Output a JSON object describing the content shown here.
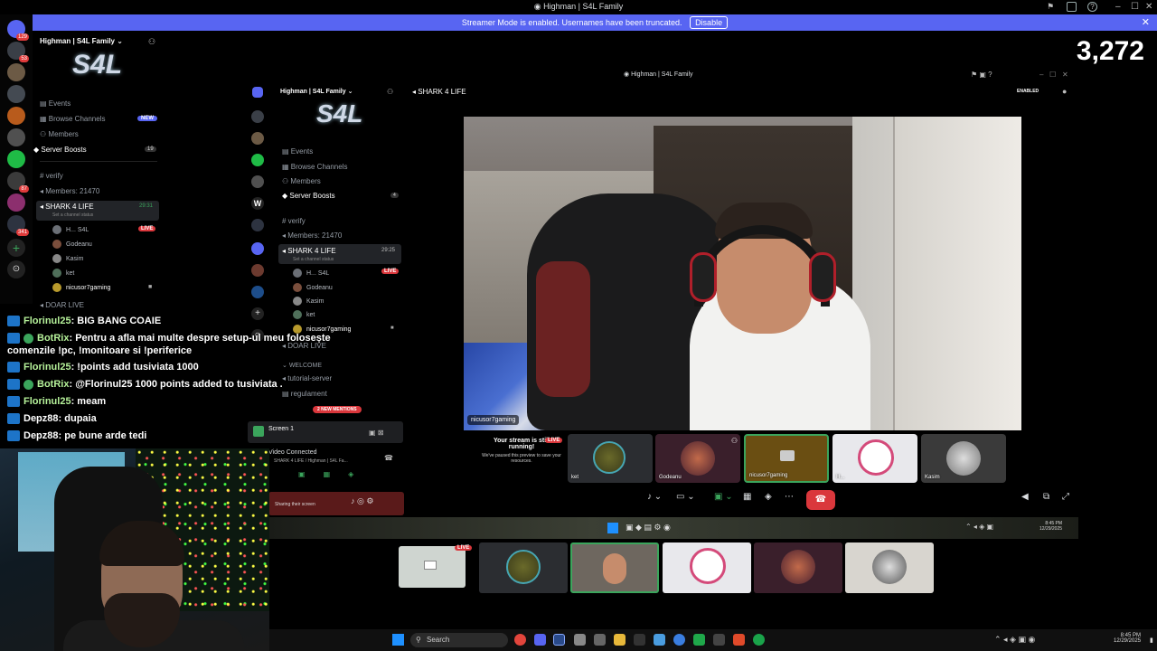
{
  "window": {
    "title": "Highman | S4L Family",
    "inner_title": "Highman | S4L Family"
  },
  "banner": {
    "text": "Streamer Mode is enabled. Usernames have been truncated.",
    "disable_label": "Disable"
  },
  "viewer_count": "3,272",
  "left_sidebar": {
    "server_name": "Highman | S4L Family",
    "logo_text": "S4L",
    "items": [
      {
        "label": "Events"
      },
      {
        "label": "Browse Channels",
        "badge": "NEW"
      },
      {
        "label": "Members"
      },
      {
        "label": "Server Boosts",
        "badge": "19"
      }
    ],
    "channels": [
      {
        "label": "verify"
      },
      {
        "label": "Members: 21470"
      },
      {
        "label": "SHARK 4 LIFE",
        "time": "29:31",
        "status": "Set a channel status"
      }
    ],
    "voice_users": [
      {
        "name": "H... S4L",
        "live": "LIVE"
      },
      {
        "name": "Godeanu"
      },
      {
        "name": "Kasim"
      },
      {
        "name": "ket"
      },
      {
        "name": "nicusor7gaming"
      }
    ],
    "after_channel": "DOAR LIVE"
  },
  "server_rail_badges": [
    "129",
    "53",
    "87",
    "341"
  ],
  "chat": [
    {
      "user": "Florinul25",
      "message": "BIG BANG COAIE"
    },
    {
      "user": "BotRix",
      "message": "Pentru a afla mai multe despre setup-ul meu folosește"
    },
    {
      "user": "",
      "message": "comenzile !pc, !monitoare si !periferice"
    },
    {
      "user": "Florinul25",
      "message": "!points add tusiviata 1000"
    },
    {
      "user": "BotRix",
      "message": "@Florinul25 1000 points added to tusiviata ."
    },
    {
      "user": "Florinul25",
      "message": "meam"
    },
    {
      "user": "Depz88",
      "message": "dupaia"
    },
    {
      "user": "Depz88",
      "message": "pe bune arde tedi"
    }
  ],
  "inner_sidebar": {
    "server_name": "Highman | S4L Family",
    "items": [
      {
        "label": "Events"
      },
      {
        "label": "Browse Channels"
      },
      {
        "label": "Members"
      },
      {
        "label": "Server Boosts",
        "badge": "4"
      }
    ],
    "channels": [
      {
        "label": "verify"
      },
      {
        "label": "Members: 21470"
      },
      {
        "label": "SHARK 4 LIFE",
        "time": "29:25",
        "status": "Set a channel status"
      }
    ],
    "voice_users": [
      {
        "name": "H... S4L",
        "live": "LIVE"
      },
      {
        "name": "Godeanu"
      },
      {
        "name": "Kasim"
      },
      {
        "name": "ket"
      },
      {
        "name": "nicusor7gaming"
      }
    ],
    "more_channels": [
      {
        "label": "DOAR LIVE"
      },
      {
        "label": "WELCOME"
      },
      {
        "label": "tutorial-server"
      },
      {
        "label": "regulament"
      }
    ],
    "mentions": "2 NEW MENTIONS",
    "screen_label": "Screen 1",
    "video_connected": "Video Connected",
    "video_channel": "SHARK 4 LIFE / Highman | S4L Fa...",
    "sharing": "Sharing their screen"
  },
  "stage": {
    "channel_header": "SHARK 4 LIFE",
    "enabled_label": "ENABLED",
    "main_name": "nicusor7gaming",
    "stream_notice_title": "Your stream is still running!",
    "stream_notice_body": "We've paused this preview to save your resources.",
    "live": "LIVE",
    "tiles": [
      {
        "name": "ket"
      },
      {
        "name": "Godeanu"
      },
      {
        "name": "nicusor7gaming"
      },
      {
        "name": "H..."
      },
      {
        "name": "Kasim"
      }
    ]
  },
  "inner_clock": {
    "time": "8:45 PM",
    "date": "12/29/2025"
  },
  "taskbar": {
    "search_placeholder": "Search",
    "time": "8:45 PM",
    "date": "12/29/2025"
  }
}
